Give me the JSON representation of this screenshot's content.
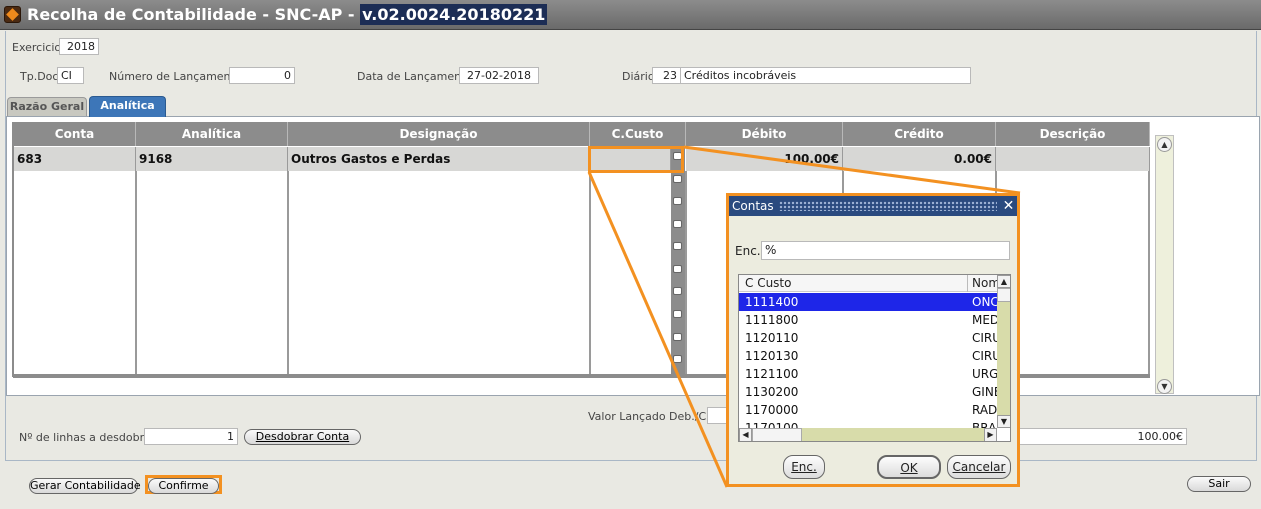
{
  "window": {
    "title_prefix": "Recolha de Contabilidade - SNC-AP - ",
    "title_version": "v.02.0024.20180221"
  },
  "header": {
    "exercicio_label": "Exercicio",
    "exercicio_value": "2018",
    "tpdoc_label": "Tp.Doc.",
    "tpdoc_value": "CI",
    "numlanc_label": "Número de Lançamento:",
    "numlanc_value": "0",
    "datalanc_label": "Data de Lançamento:",
    "datalanc_value": "27-02-2018",
    "diario_label": "Diário:",
    "diario_code": "23",
    "diario_desc": "Créditos incobráveis"
  },
  "tabs": [
    "Razão Geral",
    "Analítica"
  ],
  "grid": {
    "columns": [
      "Conta",
      "Analítica",
      "Designação",
      "C.Custo",
      "Débito",
      "Crédito",
      "Descrição"
    ],
    "row": {
      "conta": "683",
      "analitica": "9168",
      "designacao": "Outros Gastos e Perdas",
      "ccusto": "",
      "debito": "100.00€",
      "credito": "0.00€",
      "descricao": ""
    }
  },
  "footer": {
    "valor_label": "Valor Lançado Deb./Cre.",
    "linhas_label": "Nº de linhas a desdobrar:",
    "linhas_value": "1",
    "desdobrar_button": "Desdobrar Conta",
    "total_value": "100.00€",
    "gerar_button": "Gerar Contabilidade",
    "confirme_button": "Confirme",
    "sair_button": "Sair"
  },
  "dialog": {
    "title": "Contas",
    "enc_label": "Enc.",
    "enc_value": "%",
    "col_ccusto": "C Custo",
    "col_nome": "Nom",
    "rows": [
      {
        "code": "1111400",
        "name": "ONC"
      },
      {
        "code": "1111800",
        "name": "MED"
      },
      {
        "code": "1120110",
        "name": "CIRU"
      },
      {
        "code": "1120130",
        "name": "CIRU"
      },
      {
        "code": "1121100",
        "name": "URG"
      },
      {
        "code": "1130200",
        "name": "GINE"
      },
      {
        "code": "1170000",
        "name": "RAD"
      },
      {
        "code": "1170100",
        "name": "BRA"
      }
    ],
    "enc_button": "Enc.",
    "ok_button": "OK",
    "cancel_button": "Cancelar"
  },
  "colors": {
    "highlight": "#f39121",
    "selection": "#1e26e8",
    "tab_active": "#3d76b8",
    "grid_header": "#8c8c8c"
  }
}
